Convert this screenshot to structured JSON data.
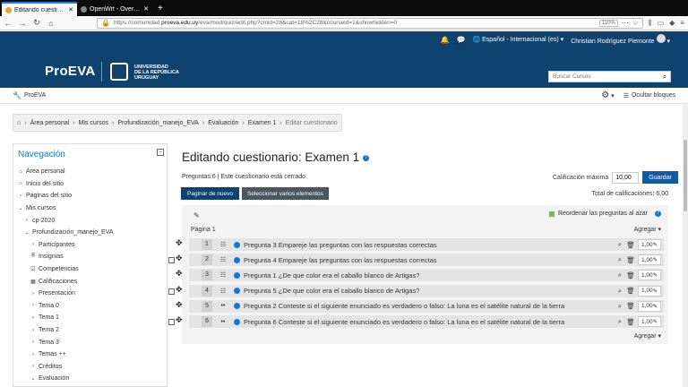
{
  "browser": {
    "tabs": [
      {
        "title": "Editando cuestionario: E",
        "active": true
      },
      {
        "title": "OpenWrt - Overview - L",
        "active": false
      }
    ],
    "new_tab": "+",
    "url_prefix": "https://comunidad.",
    "url_domain": "proeva.edu.uy",
    "url_rest": "/eva/mod/quiz/edit.php?cmid=28&cat=18%2C28&courseid=1&showhidden=0",
    "zoom": "110%"
  },
  "topbar": {
    "language": "Español - Internacional (es)",
    "user": "Christian Rodríguez Piemonte"
  },
  "header": {
    "logo": "ProEVA",
    "university": [
      "UNIVERSIDAD",
      "DE LA REPÚBLICA",
      "URUGUAY"
    ],
    "search_placeholder": "Buscar Cursos"
  },
  "subbar": {
    "site": "ProEVA",
    "hide_blocks": "Ocultar bloques"
  },
  "breadcrumb": [
    "Área personal",
    "Mis cursos",
    "Profundización_manejo_EVA",
    "Evaluación",
    "Examen 1",
    "Editar cuestionario"
  ],
  "sidebar": {
    "title": "Navegación",
    "items": [
      {
        "label": "Área personal",
        "icon": "home-icon",
        "indent": 0
      },
      {
        "label": "Inicio del sitio",
        "icon": "home-icon",
        "indent": 0
      },
      {
        "label": "Páginas del sitio",
        "icon": "chevron-right-icon",
        "indent": 0
      },
      {
        "label": "Mis cursos",
        "icon": "chevron-down-icon",
        "indent": 0
      },
      {
        "label": "cp-2020",
        "icon": "chevron-right-icon",
        "indent": 1
      },
      {
        "label": "Profundización_manejo_EVA",
        "icon": "chevron-down-icon",
        "indent": 1
      },
      {
        "label": "Participantes",
        "icon": "chevron-right-icon",
        "indent": 2
      },
      {
        "label": "Insignias",
        "icon": "shield-icon",
        "indent": 2
      },
      {
        "label": "Competencias",
        "icon": "check-square-icon",
        "indent": 2
      },
      {
        "label": "Calificaciones",
        "icon": "table-icon",
        "indent": 2
      },
      {
        "label": "Presentación",
        "icon": "chevron-right-icon",
        "indent": 2
      },
      {
        "label": "Tema 0",
        "icon": "chevron-right-icon",
        "indent": 2
      },
      {
        "label": "Tema 1",
        "icon": "chevron-right-icon",
        "indent": 2
      },
      {
        "label": "Tema 2",
        "icon": "chevron-right-icon",
        "indent": 2
      },
      {
        "label": "Tema 3",
        "icon": "chevron-right-icon",
        "indent": 2
      },
      {
        "label": "Temas ++",
        "icon": "chevron-right-icon",
        "indent": 2
      },
      {
        "label": "Créditos",
        "icon": "chevron-right-icon",
        "indent": 2
      },
      {
        "label": "Evaluación",
        "icon": "chevron-down-icon",
        "indent": 2
      }
    ]
  },
  "main": {
    "title": "Editando cuestionario: Examen 1",
    "info": "Preguntas:6 | Este cuestionario está cerrado",
    "max_grade_label": "Calificación máxima",
    "max_grade_value": "10,00",
    "save_label": "Guardar",
    "repaginate_label": "Paginar de nuevo",
    "select_multiple_label": "Seleccionar varios elementos",
    "total_grades": "Total de calificaciones: 6,00",
    "shuffle_label": "Reordenar las preguntas al azar",
    "page_label": "Página 1",
    "add_label": "Agregar",
    "questions": [
      {
        "num": "1",
        "type": "matching",
        "text": "Pregunta 3 Empareje las preguntas con las respuestas correctas",
        "grade": "1,00"
      },
      {
        "num": "2",
        "type": "matching",
        "text": "Pregunta 4 Empareje las preguntas con las respuestas correctas",
        "grade": "1,00"
      },
      {
        "num": "3",
        "type": "matching",
        "text": "Pregunta 1 ¿De que color era el caballo blanco de Artigas?",
        "grade": "1,00"
      },
      {
        "num": "4",
        "type": "matching",
        "text": "Pregunta 5 ¿De que color era el caballo blanco de Artigas?",
        "grade": "1,00"
      },
      {
        "num": "5",
        "type": "truefalse",
        "text": "Pregunta 2 Conteste si el siguiente enunciado es verdadero o falso: La luna es el satélite natural de la tierra",
        "grade": "1,00"
      },
      {
        "num": "6",
        "type": "truefalse",
        "text": "Pregunta 6 Conteste si el siguiente enunciado es verdadero o falso: La luna es el satélite natural de la tierra",
        "grade": "1,00"
      }
    ]
  }
}
